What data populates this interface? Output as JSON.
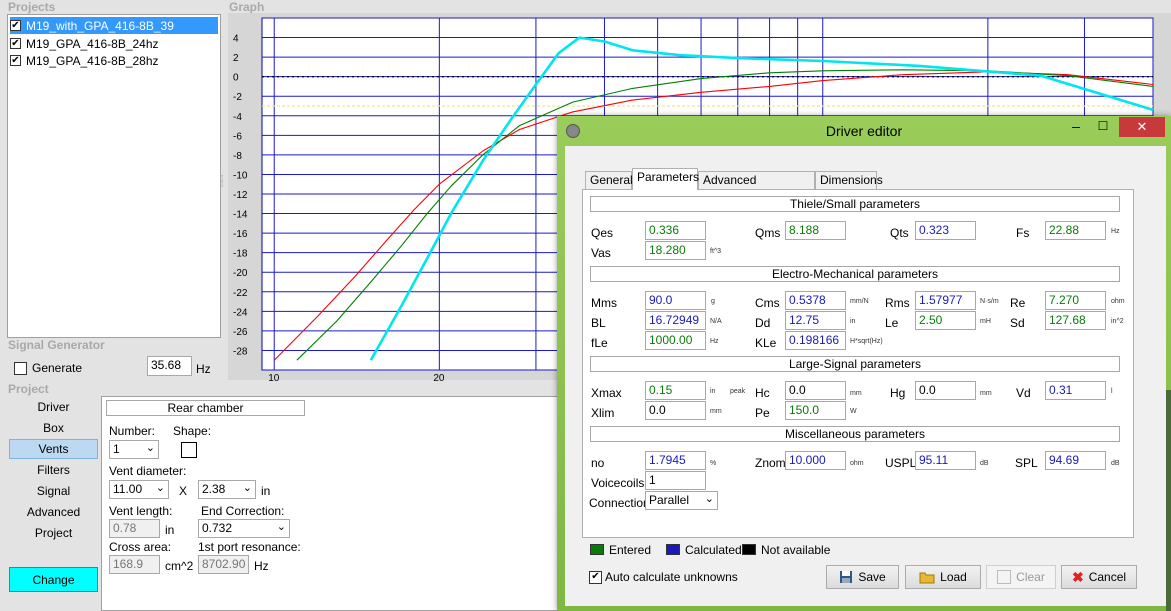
{
  "projects": {
    "title": "Projects",
    "items": [
      {
        "label": "M19_with_GPA_416-8B_39",
        "checked": "✔",
        "selected": true
      },
      {
        "label": "M19_GPA_416-8B_24hz",
        "checked": "✔",
        "selected": false
      },
      {
        "label": "M19_GPA_416-8B_28hz",
        "checked": "✔",
        "selected": false
      }
    ]
  },
  "signal_generator": {
    "title": "Signal Generator",
    "generate_label": "Generate",
    "frequency": "35.68",
    "unit": "Hz"
  },
  "project_nav": {
    "title": "Project",
    "items": [
      "Driver",
      "Box",
      "Vents",
      "Filters",
      "Signal",
      "Advanced",
      "Project"
    ],
    "selected": "Vents",
    "change_label": "Change"
  },
  "vents": {
    "rear_chamber": "Rear chamber",
    "number_label": "Number:",
    "number_value": "1",
    "shape_label": "Shape:",
    "vent_diameter_label": "Vent diameter:",
    "diameter_a": "11.00",
    "times": "X",
    "diameter_b": "2.38",
    "diameter_unit": "in",
    "vent_length_label": "Vent length:",
    "vent_length_value": "0.78",
    "vent_length_unit": "in",
    "end_correction_label": "End Correction:",
    "end_correction_value": "0.732",
    "cross_area_label": "Cross area:",
    "cross_area_value": "168.9",
    "cross_area_unit": "cm^2",
    "port_res_label": "1st port resonance:",
    "port_res_value": "8702.90",
    "port_res_unit": "Hz"
  },
  "graph": {
    "title": "Graph"
  },
  "chart_data": {
    "type": "line",
    "xlabel": "",
    "ylabel": "",
    "x_scale": "log",
    "x_ticks": [
      "10",
      "20"
    ],
    "y_ticks": [
      "4",
      "2",
      "0",
      "-2",
      "-4",
      "-6",
      "-8",
      "-10",
      "-12",
      "-14",
      "-16",
      "-18",
      "-20",
      "-22",
      "-24",
      "-26",
      "-28"
    ],
    "ylim": [
      -30,
      6
    ],
    "grid": true,
    "reference_lines": [
      {
        "y": 0,
        "style": "dotted",
        "color": "#000000"
      },
      {
        "y": -3,
        "style": "dashed",
        "color": "#f0e68c"
      }
    ],
    "series": [
      {
        "color": "#ff0000",
        "x": [
          10,
          12,
          14,
          16,
          18,
          20,
          24,
          28,
          35,
          45,
          60,
          80,
          100,
          140,
          200,
          280,
          400
        ],
        "y": [
          -29,
          -24.5,
          -20.5,
          -16.8,
          -13.6,
          -11,
          -7.6,
          -5.4,
          -3.6,
          -2.4,
          -1.6,
          -1.0,
          -0.4,
          0.2,
          0.5,
          0.2,
          -0.8
        ]
      },
      {
        "color": "#008000",
        "x": [
          11,
          13,
          15,
          17,
          19,
          21,
          24,
          28,
          35,
          45,
          60,
          80,
          100,
          140,
          200,
          280,
          400
        ],
        "y": [
          -29,
          -25,
          -21,
          -17.4,
          -14,
          -11.2,
          -8,
          -5,
          -2.6,
          -1.2,
          -0.2,
          0.4,
          0.6,
          0.7,
          0.6,
          0.1,
          -1.0
        ]
      },
      {
        "color": "#00e5ee",
        "x": [
          15,
          17,
          19,
          21,
          24,
          27,
          30,
          33,
          36,
          40,
          45,
          55,
          70,
          100,
          150,
          250,
          400
        ],
        "y": [
          -29,
          -23.6,
          -18.6,
          -14,
          -8.6,
          -4.4,
          -0.8,
          2.4,
          4.0,
          3.6,
          2.7,
          2.2,
          1.9,
          1.6,
          1.1,
          0.1,
          -3.4
        ]
      }
    ]
  },
  "driver_editor": {
    "title": "Driver editor",
    "minimize": "–",
    "maximize": "☐",
    "close": "✕",
    "tabs": [
      "General",
      "Parameters",
      "Advanced parameters",
      "Dimensions"
    ],
    "active_tab": "Parameters",
    "sections": {
      "ts": "Thiele/Small parameters",
      "em": "Electro-Mechanical parameters",
      "ls": "Large-Signal parameters",
      "misc": "Miscellaneous parameters"
    },
    "params": {
      "qes": {
        "label": "Qes",
        "value": "0.336"
      },
      "qms": {
        "label": "Qms",
        "value": "8.188"
      },
      "qts": {
        "label": "Qts",
        "value": "0.323"
      },
      "fs": {
        "label": "Fs",
        "value": "22.88",
        "unit": "Hz"
      },
      "vas": {
        "label": "Vas",
        "value": "18.280",
        "unit": "ft^3"
      },
      "mms": {
        "label": "Mms",
        "value": "90.0",
        "unit": "g"
      },
      "cms": {
        "label": "Cms",
        "value": "0.5378",
        "unit": "mm/N"
      },
      "rms": {
        "label": "Rms",
        "value": "1.57977",
        "unit": "N·s/m"
      },
      "re": {
        "label": "Re",
        "value": "7.270",
        "unit": "ohm"
      },
      "bl": {
        "label": "BL",
        "value": "16.72949",
        "unit": "N/A"
      },
      "dd": {
        "label": "Dd",
        "value": "12.75",
        "unit": "in"
      },
      "le": {
        "label": "Le",
        "value": "2.50",
        "unit": "mH"
      },
      "sd": {
        "label": "Sd",
        "value": "127.68",
        "unit": "in^2"
      },
      "fle": {
        "label": "fLe",
        "value": "1000.00",
        "unit": "Hz"
      },
      "kle": {
        "label": "KLe",
        "value": "0.198166",
        "unit": "H*sqrt(Hz)"
      },
      "xmax": {
        "label": "Xmax",
        "value": "0.15",
        "unit": "in",
        "extra": "peak"
      },
      "hc": {
        "label": "Hc",
        "value": "0.0",
        "unit": "mm"
      },
      "hg": {
        "label": "Hg",
        "value": "0.0",
        "unit": "mm"
      },
      "vd": {
        "label": "Vd",
        "value": "0.31",
        "unit": "l"
      },
      "xlim": {
        "label": "Xlim",
        "value": "0.0",
        "unit": "mm"
      },
      "pe": {
        "label": "Pe",
        "value": "150.0",
        "unit": "W"
      },
      "no": {
        "label": "no",
        "value": "1.7945",
        "unit": "%"
      },
      "znom": {
        "label": "Znom",
        "value": "10.000",
        "unit": "ohm"
      },
      "uspl": {
        "label": "USPL",
        "value": "95.11",
        "unit": "dB"
      },
      "spl": {
        "label": "SPL",
        "value": "94.69",
        "unit": "dB"
      },
      "voicecoils": {
        "label": "Voicecoils",
        "value": "1"
      },
      "connection": {
        "label": "Connection",
        "value": "Parallel"
      }
    },
    "legend": {
      "entered": "Entered",
      "calculated": "Calculated",
      "not_available": "Not available",
      "entered_color": "#0a7a0a",
      "calculated_color": "#1a1ab8",
      "na_color": "#000000"
    },
    "auto_calc": "Auto calculate unknowns",
    "buttons": {
      "save": "Save",
      "load": "Load",
      "clear": "Clear",
      "cancel": "Cancel"
    }
  }
}
